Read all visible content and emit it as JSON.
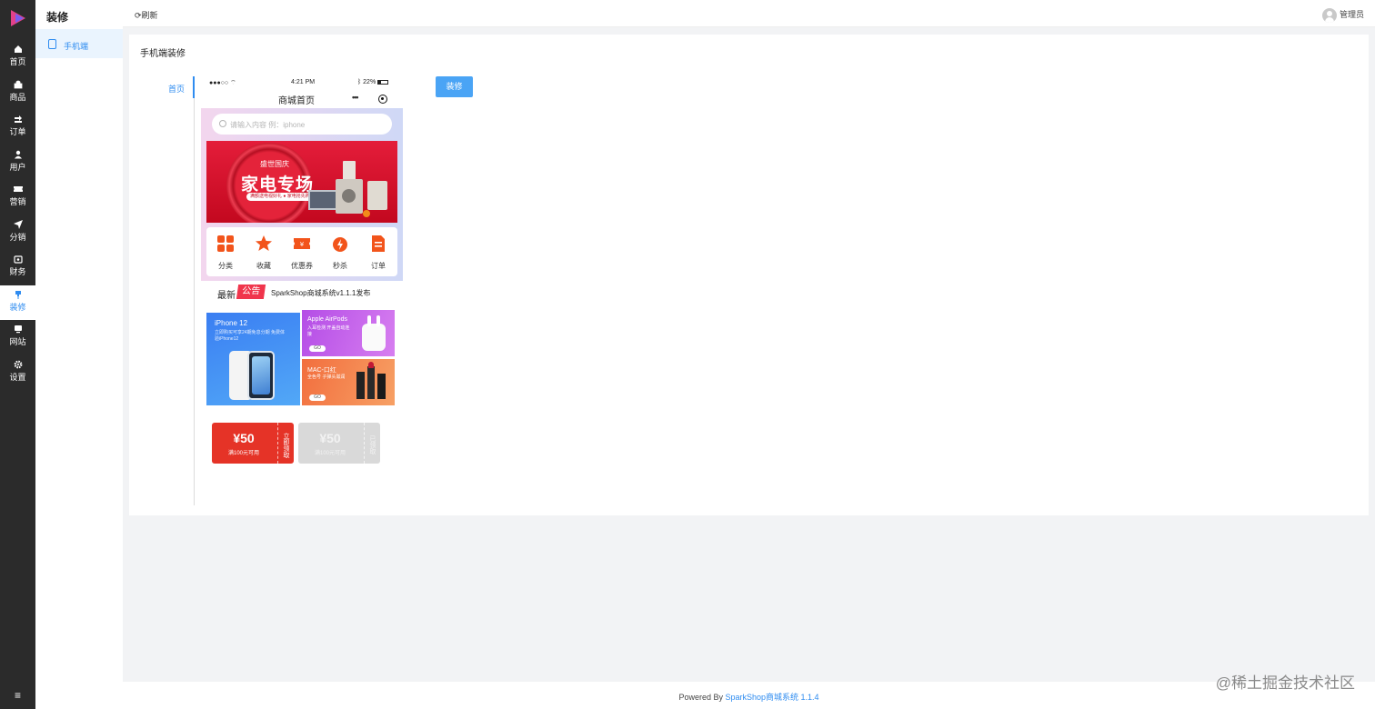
{
  "nav": {
    "items": [
      {
        "label": "首页",
        "icon": "home-icon"
      },
      {
        "label": "商品",
        "icon": "bag-icon"
      },
      {
        "label": "订单",
        "icon": "order-icon"
      },
      {
        "label": "用户",
        "icon": "user-icon"
      },
      {
        "label": "营销",
        "icon": "ticket-icon"
      },
      {
        "label": "分销",
        "icon": "send-icon"
      },
      {
        "label": "财务",
        "icon": "wallet-icon"
      },
      {
        "label": "装修",
        "icon": "brush-icon"
      },
      {
        "label": "网站",
        "icon": "monitor-icon"
      },
      {
        "label": "设置",
        "icon": "gear-icon"
      }
    ],
    "active_index": 7,
    "menu_glyph": "≡"
  },
  "subnav": {
    "title": "装修",
    "items": [
      {
        "label": "手机端"
      }
    ]
  },
  "topbar": {
    "refresh_label": "刷新",
    "admin_label": "管理员"
  },
  "card": {
    "title": "手机端装修",
    "tabs": [
      {
        "label": "首页"
      }
    ],
    "decorate_button": "装修"
  },
  "phone": {
    "status": {
      "signal": "●●●○○",
      "time": "4:21 PM",
      "battery": "22%"
    },
    "nav_title": "商城首页",
    "more_glyph": "•••",
    "search_placeholder": "请输入内容 例：iphone",
    "banner": {
      "subtitle": "盛世国庆",
      "title": "家电专场",
      "tag": "满额送电视好礼 ● 家电抢先购"
    },
    "quick_links": [
      {
        "label": "分类",
        "icon": "grid-icon"
      },
      {
        "label": "收藏",
        "icon": "star-icon"
      },
      {
        "label": "优惠券",
        "icon": "coupon-icon"
      },
      {
        "label": "秒杀",
        "icon": "flash-icon"
      },
      {
        "label": "订单",
        "icon": "list-icon"
      }
    ],
    "notice": {
      "prefix": "最新",
      "badge": "公告",
      "text": "SparkShop商城系统v1.1.1发布"
    },
    "promos": [
      {
        "title": "iPhone 12",
        "desc": "立即购买可享24期免息分期 免费体验iPhone12"
      },
      {
        "title": "Apple AirPods",
        "desc": "入耳检测 开盖自动连接",
        "go": "GO"
      },
      {
        "title": "MAC-口红",
        "desc": "全色号 子弹头滋润",
        "go": "GO"
      }
    ],
    "coupons": [
      {
        "amount": "¥50",
        "condition": "满100元可用",
        "action": "立即领取",
        "state": "available"
      },
      {
        "amount": "¥50",
        "condition": "满100元可用",
        "action": "已领取",
        "state": "claimed"
      }
    ]
  },
  "footer": {
    "prefix": "Powered By ",
    "link": "SparkShop商城系统 1.1.4"
  },
  "watermark": "@稀土掘金技术社区",
  "colors": {
    "accent": "#2f8cf0",
    "nav_bg": "#2b2b2b",
    "coupon_red": "#e53327",
    "icon_orange": "#f2541b"
  }
}
